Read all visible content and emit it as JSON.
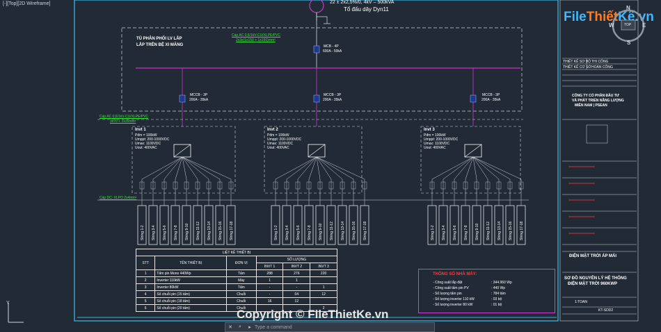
{
  "viewport": {
    "label": "[-][Top][2D Wireframe]"
  },
  "header": {
    "transformer_text": "22 ± 2x2,5%/0, 4kV – 500kVA",
    "group_text": "Tổ đấu dây Dyn11"
  },
  "panel": {
    "title_line1": "TỦ PHÂN PHỐI LV LẮP",
    "title_line2": "LẮP TRÊN BỆ XI MĂNG"
  },
  "cables": {
    "top_cable_line1": "Cáp AC 0,6/1kV-CU/XLPE/PVC",
    "top_cable_line2": "2x3x(1x150 + 1x150)mm²",
    "feeder_cable_line1": "Cáp AC 0,6/1kV-CU/XLPE/PVC",
    "feeder_cable_line2": "3x70 + 1x35mm²",
    "dc_cable": "Cáp DC: XLPO 2x4mm²"
  },
  "main_breaker": {
    "name": "MCB - 4P",
    "rating": "600A - 50kA"
  },
  "breakers": [
    {
      "name": "MCCB - 3P",
      "rating": "200A - 35kA"
    },
    {
      "name": "MCCB - 3P",
      "rating": "200A - 35kA"
    },
    {
      "name": "MCCB - 3P",
      "rating": "200A - 35kA"
    }
  ],
  "inverters": [
    {
      "name": "Invt 1",
      "specs": [
        "Pđm = 100kW",
        "Umppt: 200-1000VDC",
        "Umax: 1100VDC",
        "Uout: 400VAC"
      ]
    },
    {
      "name": "Invt 2",
      "specs": [
        "Pđm = 100kW",
        "Umppt: 200-1000VDC",
        "Umax: 1100VDC",
        "Uout: 400VAC"
      ]
    },
    {
      "name": "Invt 3",
      "specs": [
        "Pđm = 100kW",
        "Umppt: 200-1000VDC",
        "Umax: 1100VDC",
        "Uout: 400VAC"
      ]
    }
  ],
  "strings": [
    "String 1-2",
    "String 3-4",
    "String 5-6",
    "String 7-8",
    "String 9-10",
    "String 11-12",
    "String 13-14",
    "String 15-16",
    "String 17-18"
  ],
  "equipment_table": {
    "title": "LIỆT KÊ THIẾT BỊ",
    "qty_header": "SỐ LƯỢNG",
    "col_stt": "STT",
    "col_name": "TÊN THIẾT BỊ",
    "col_unit": "ĐƠN VỊ",
    "col_i1": "INVT 1",
    "col_i2": "INVT 2",
    "col_i3": "INVT 3",
    "rows": [
      {
        "stt": "1",
        "name": "Tấm pin Mono 440Wp",
        "unit": "Tấm",
        "i1": "288",
        "i2": "276",
        "i3": "220"
      },
      {
        "stt": "2",
        "name": "Inverter 110kW",
        "unit": "Máy",
        "i1": "1",
        "i2": "1",
        "i3": ""
      },
      {
        "stt": "3",
        "name": "Inverter 80kW",
        "unit": "Tấm",
        "i1": "-",
        "i2": "-",
        "i3": "1"
      },
      {
        "stt": "4",
        "name": "Số chuỗi pin (15 tấm)",
        "unit": "Chuỗi",
        "i1": "-",
        "i2": "04",
        "i3": "12"
      },
      {
        "stt": "5",
        "name": "Số chuỗi pin (18 tấm)",
        "unit": "Chuỗi",
        "i1": "16",
        "i2": "12",
        "i3": ""
      },
      {
        "stt": "6",
        "name": "Số chuỗi pin (20 tấm)",
        "unit": "Chuỗi",
        "i1": "",
        "i2": "",
        "i3": "2"
      }
    ]
  },
  "params": {
    "title": "THÔNG SỐ NHÀ MÁY:",
    "rows": [
      {
        "label": "- Công suất lắp đặt",
        "value": ": 344.960 Wp"
      },
      {
        "label": "- Công suất tấm pin PV",
        "value": ": 440 Wp"
      },
      {
        "label": "- Số lượng tấm pin",
        "value": ": 784 tấm"
      },
      {
        "label": "- Số lượng inverter 110 kW",
        "value": ": 03 bộ"
      },
      {
        "label": "- Số lượng inverter 80 kW",
        "value": ": 01 bộ"
      }
    ]
  },
  "title_block": {
    "cell1": "THIẾT KẾ SƠ BỘ",
    "cell2": "THI CÔNG",
    "cell3": "THIẾT KẾ CƠ SỞ",
    "cell4": "HOÀN CÔNG",
    "company_line1": "CÔNG TY CỔ PHẦN ĐẦU TƯ",
    "company_line2": "VÀ PHÁT TRIỂN NĂNG LƯỢNG",
    "company_line3": "MIỀN NAM | PSEAN",
    "project": "ĐIỆN MẶT TRỜI ÁP MÁI",
    "drawing_title_line1": "SƠ ĐỒ NGUYÊN LÝ HỆ THỐNG",
    "drawing_title_line2": "ĐIỆN MẶT TRỜI 960KWP",
    "sheet": "KT-SDD2",
    "scale": "1:TOAN"
  },
  "logo": {
    "part1": "File",
    "part2": "Thiết",
    "part3": "Kế.vn"
  },
  "compass": {
    "n": "N",
    "e": "E",
    "s": "S",
    "w": "W",
    "top": "TOP"
  },
  "command": {
    "placeholder": "Type a command"
  },
  "watermark": {
    "text": "Copyright © FileThietKe.vn"
  },
  "colors": {
    "background": "#212a35",
    "busbar": "#b32db3",
    "cable_label": "#39e23a",
    "accent_red": "#ff3b3b",
    "frame": "#3bb5e0"
  }
}
